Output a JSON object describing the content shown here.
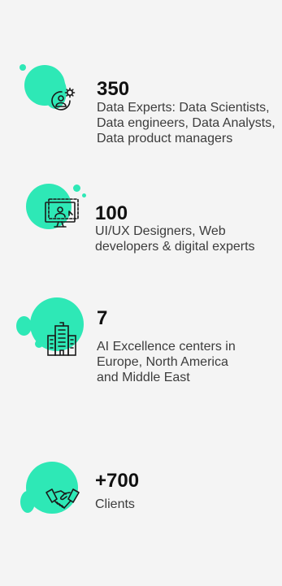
{
  "accent_color": "#2ee8b6",
  "stats": [
    {
      "number": "350",
      "description": "Data Experts: Data Scientists, Data engineers, Data Analysts, Data product managers",
      "icon": "person-gear-icon"
    },
    {
      "number": "100",
      "description": "UI/UX Designers, Web developers & digital experts",
      "icon": "monitor-designer-icon"
    },
    {
      "number": "7",
      "description": "AI Excellence centers in Europe, North America and Middle East",
      "icon": "office-building-icon"
    },
    {
      "number": "+700",
      "description": "Clients",
      "icon": "handshake-icon"
    }
  ]
}
